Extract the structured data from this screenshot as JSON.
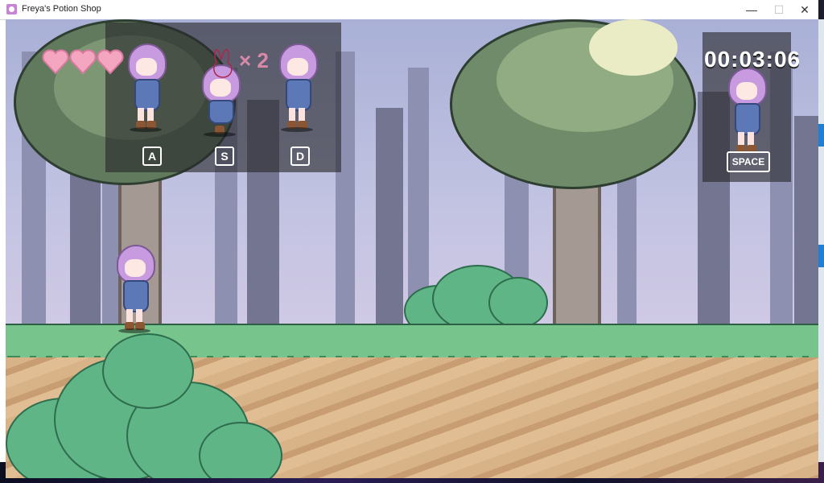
{
  "window": {
    "title": "Freya's Potion Shop",
    "controls": {
      "minimize": "—",
      "maximize": "☐",
      "close": "✕"
    }
  },
  "hud": {
    "lives": 3,
    "timer": "00:03:06",
    "multiplier": "× 2",
    "keys": {
      "a": "A",
      "s": "S",
      "d": "D",
      "space": "SPACE"
    }
  },
  "colors": {
    "heart": "#f4a6c1",
    "hair": "#c89be0",
    "grass": "#78c48d",
    "dirt": "#d8b388"
  },
  "icons": [
    "app-icon",
    "heart-icon",
    "bunny-outline-icon"
  ]
}
